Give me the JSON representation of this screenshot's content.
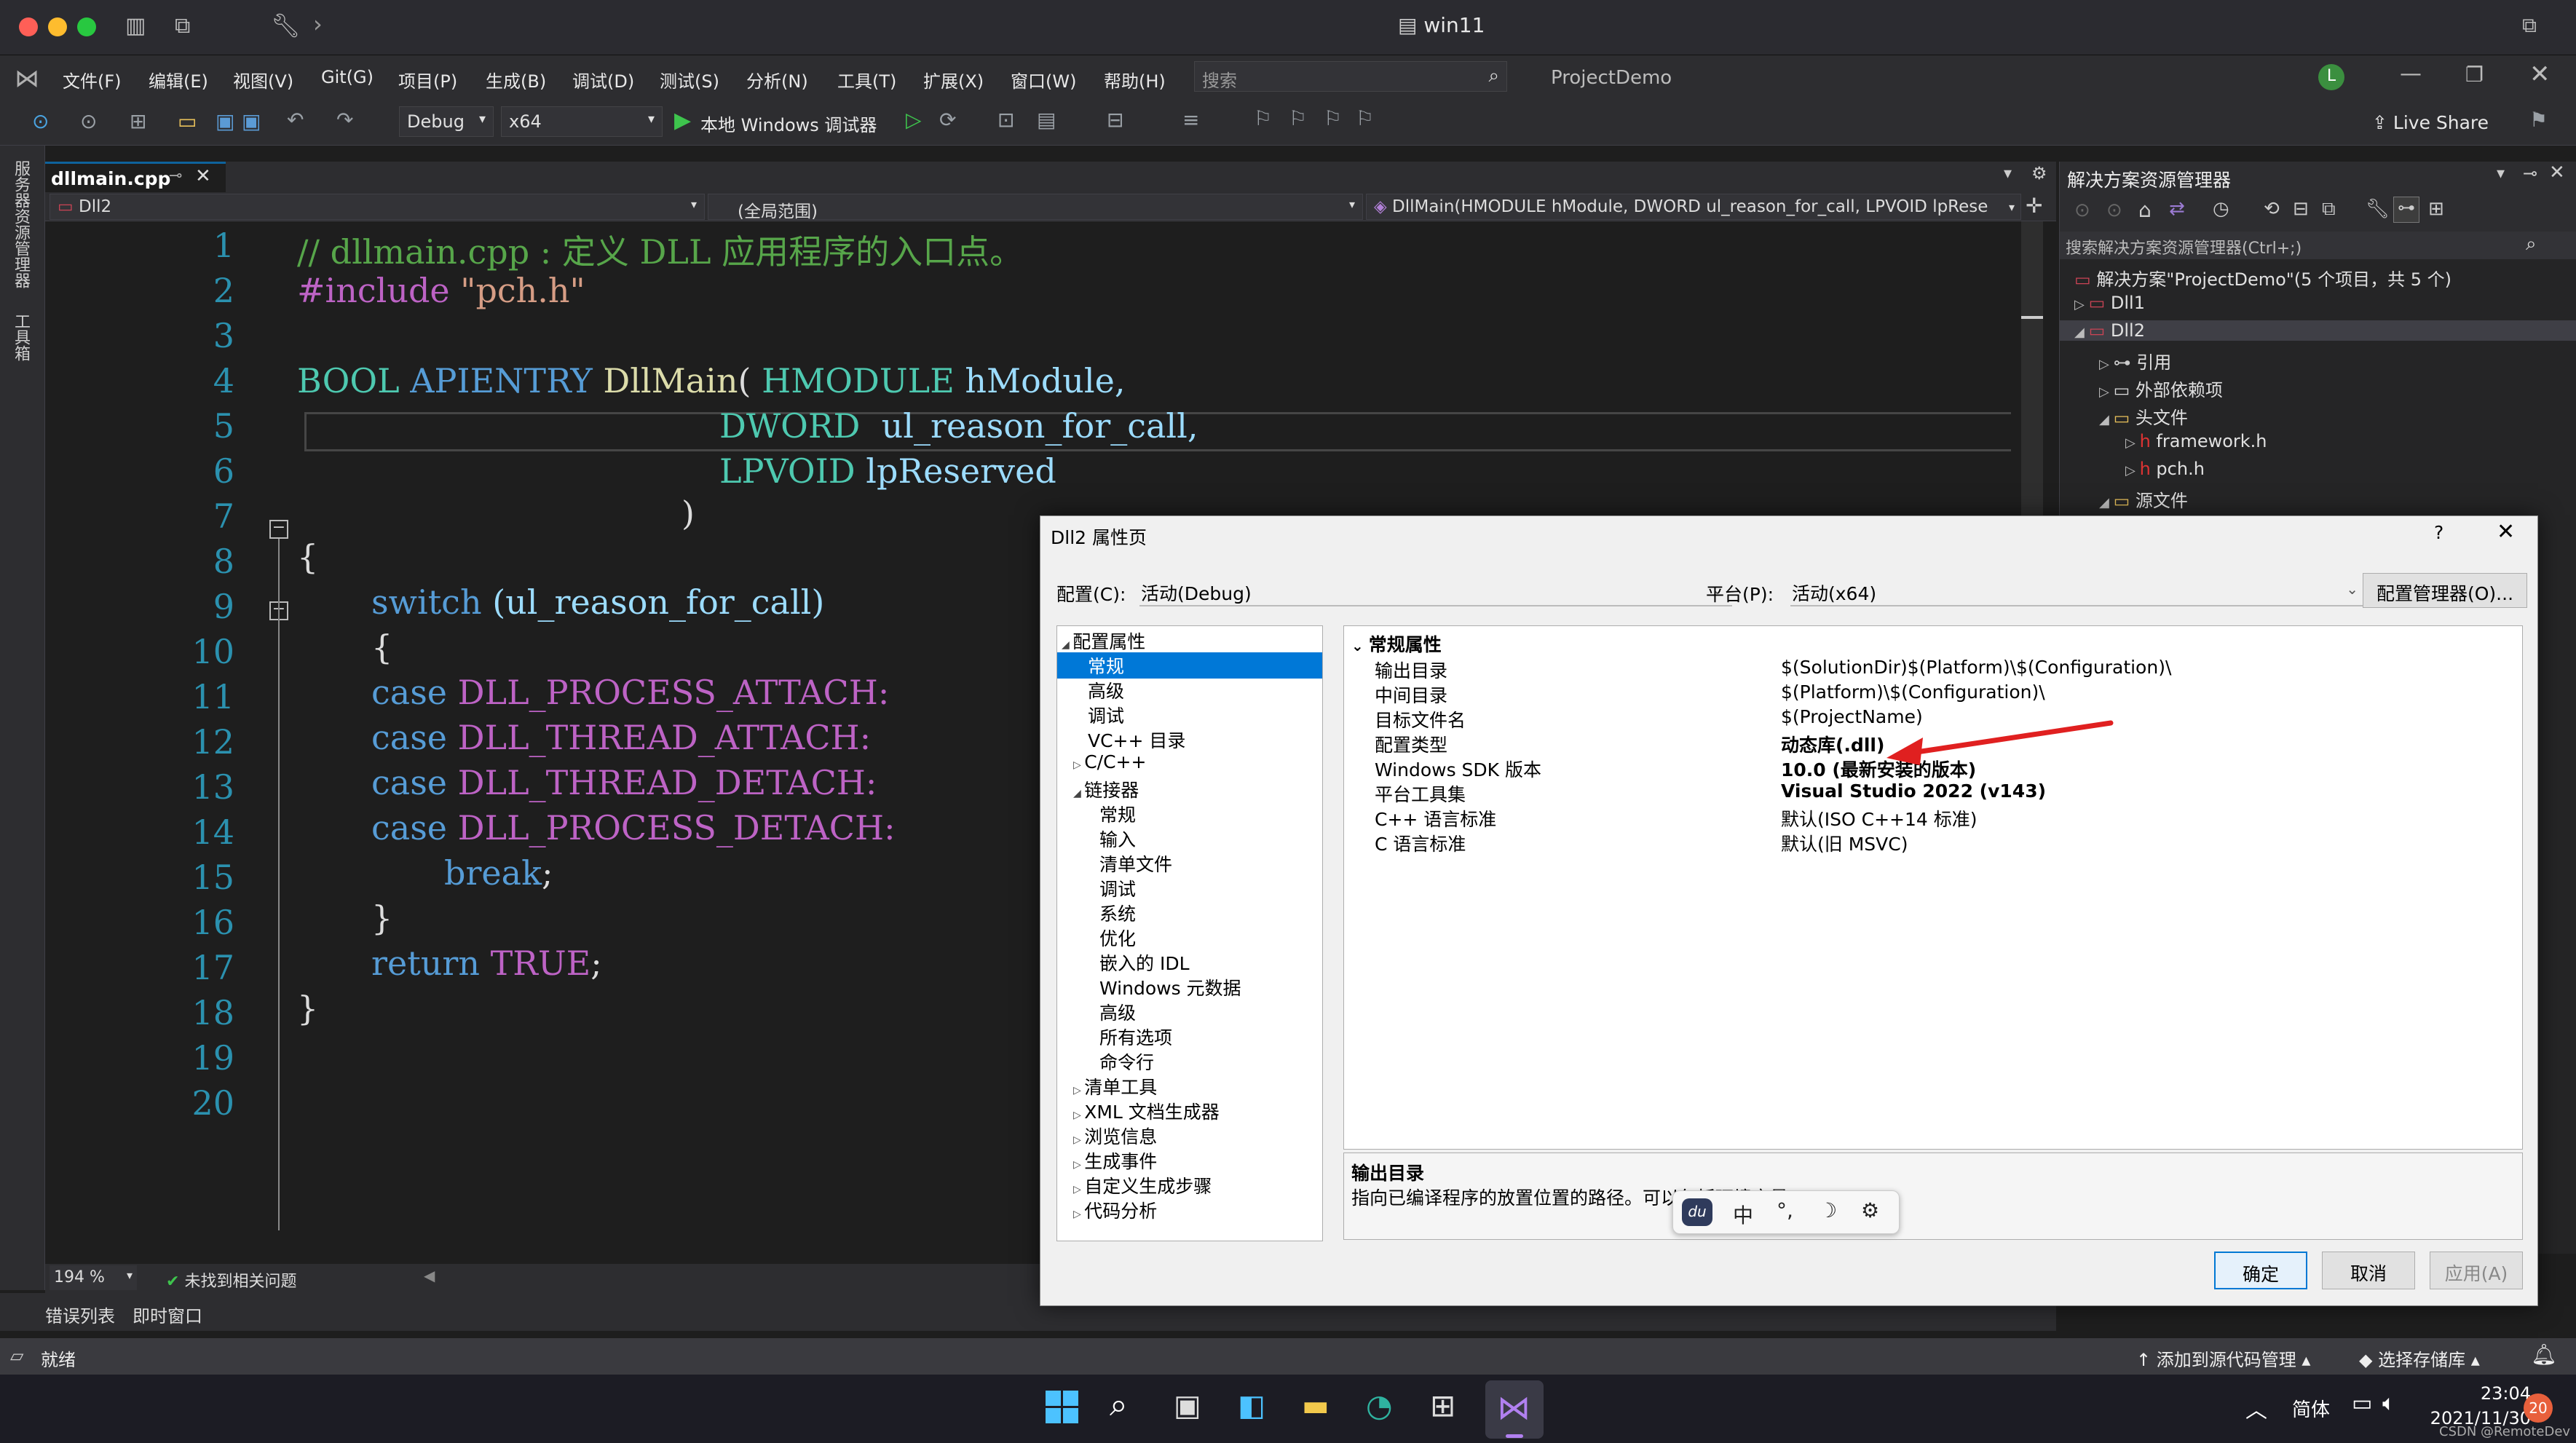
{
  "window": {
    "title": "win11"
  },
  "menu": [
    "文件(F)",
    "编辑(E)",
    "视图(V)",
    "Git(G)",
    "项目(P)",
    "生成(B)",
    "调试(D)",
    "测试(S)",
    "分析(N)",
    "工具(T)",
    "扩展(X)",
    "窗口(W)",
    "帮助(H)"
  ],
  "search": {
    "placeholder": "搜索"
  },
  "project_name": "ProjectDemo",
  "user_initial": "L",
  "toolbar": {
    "config": "Debug",
    "platform": "x64",
    "run_label": "本地 Windows 调试器",
    "live_share": "Live Share"
  },
  "left_strip": {
    "server_explorer": "服务器资源管理器",
    "toolbox": "工具箱"
  },
  "editor": {
    "tab_name": "dllmain.cpp",
    "nav_project": "Dll2",
    "nav_scope": "(全局范围)",
    "nav_function": "DllMain(HMODULE hModule, DWORD ul_reason_for_call, LPVOID lpRese",
    "zoom": "194 %",
    "issues": "未找到相关问题",
    "line_numbers": [
      "1",
      "2",
      "3",
      "4",
      "5",
      "6",
      "7",
      "8",
      "9",
      "10",
      "11",
      "12",
      "13",
      "14",
      "15",
      "16",
      "17",
      "18",
      "19",
      "20"
    ]
  },
  "code": {
    "l1": "// dllmain.cpp : 定义 DLL 应用程序的入口点。",
    "l2a": "#include ",
    "l2b": "\"pch.h\"",
    "l4a": "BOOL",
    "l4b": " APIENTRY ",
    "l4c": "DllMain",
    "l4d": "( ",
    "l4e": "HMODULE",
    "l4f": " hModule,",
    "l5a": "DWORD",
    "l5b": "  ul_reason_for_call,",
    "l6a": "LPVOID",
    "l6b": " lpReserved",
    "l7": ")",
    "l8": "{",
    "l9a": "switch",
    "l9b": " (ul_reason_for_call)",
    "l10": "{",
    "l11a": "case",
    "l11b": " DLL_PROCESS_ATTACH:",
    "l12a": "case",
    "l12b": " DLL_THREAD_ATTACH:",
    "l13a": "case",
    "l13b": " DLL_THREAD_DETACH:",
    "l14a": "case",
    "l14b": " DLL_PROCESS_DETACH:",
    "l15a": "break",
    "l15b": ";",
    "l16": "}",
    "l17a": "return",
    "l17b": " TRUE",
    "l17c": ";",
    "l18": "}"
  },
  "bottom_tabs": [
    "错误列表",
    "即时窗口"
  ],
  "status": {
    "ready": "就绪",
    "add_source": "添加到源代码管理",
    "select_repo": "选择存储库"
  },
  "solution_explorer": {
    "title": "解决方案资源管理器",
    "search_placeholder": "搜索解决方案资源管理器(Ctrl+;)",
    "items": [
      {
        "label": "解决方案\"ProjectDemo\"(5 个项目，共 5 个)"
      },
      {
        "label": "Dll1"
      },
      {
        "label": "Dll2"
      },
      {
        "label": "引用"
      },
      {
        "label": "外部依赖项"
      },
      {
        "label": "头文件"
      },
      {
        "label": "framework.h"
      },
      {
        "label": "pch.h"
      },
      {
        "label": "源文件"
      }
    ]
  },
  "dialog": {
    "title": "Dll2 属性页",
    "help": "?",
    "config_label": "配置(C):",
    "config_value": "活动(Debug)",
    "platform_label": "平台(P):",
    "platform_value": "活动(x64)",
    "config_manager": "配置管理器(O)...",
    "tree": [
      {
        "label": "配置属性"
      },
      {
        "label": "常规"
      },
      {
        "label": "高级"
      },
      {
        "label": "调试"
      },
      {
        "label": "VC++ 目录"
      },
      {
        "label": "C/C++"
      },
      {
        "label": "链接器"
      },
      {
        "label": "常规"
      },
      {
        "label": "输入"
      },
      {
        "label": "清单文件"
      },
      {
        "label": "调试"
      },
      {
        "label": "系统"
      },
      {
        "label": "优化"
      },
      {
        "label": "嵌入的 IDL"
      },
      {
        "label": "Windows 元数据"
      },
      {
        "label": "高级"
      },
      {
        "label": "所有选项"
      },
      {
        "label": "命令行"
      },
      {
        "label": "清单工具"
      },
      {
        "label": "XML 文档生成器"
      },
      {
        "label": "浏览信息"
      },
      {
        "label": "生成事件"
      },
      {
        "label": "自定义生成步骤"
      },
      {
        "label": "代码分析"
      }
    ],
    "section": "常规属性",
    "properties": [
      {
        "name": "输出目录",
        "value": "$(SolutionDir)$(Platform)\\$(Configuration)\\"
      },
      {
        "name": "中间目录",
        "value": "$(Platform)\\$(Configuration)\\"
      },
      {
        "name": "目标文件名",
        "value": "$(ProjectName)"
      },
      {
        "name": "配置类型",
        "value": "动态库(.dll)"
      },
      {
        "name": "Windows SDK 版本",
        "value": "10.0 (最新安装的版本)"
      },
      {
        "name": "平台工具集",
        "value": "Visual Studio 2022 (v143)"
      },
      {
        "name": "C++ 语言标准",
        "value": "默认(ISO C++14 标准)"
      },
      {
        "name": "C 语言标准",
        "value": "默认(旧 MSVC)"
      }
    ],
    "desc_title": "输出目录",
    "desc_text": "指向已编译程序的放置位置的路径。可以包括环境变量。",
    "ime": {
      "logo": "du",
      "zh": "中",
      "punct": "°,",
      "moon": "☽",
      "gear": "⚙"
    },
    "ok": "确定",
    "cancel": "取消",
    "apply": "应用(A)"
  },
  "taskbar": {
    "lang": "简体",
    "time": "23:04",
    "date": "2021/11/30",
    "badge": "20",
    "watermark": "CSDN @RemoteDev"
  }
}
